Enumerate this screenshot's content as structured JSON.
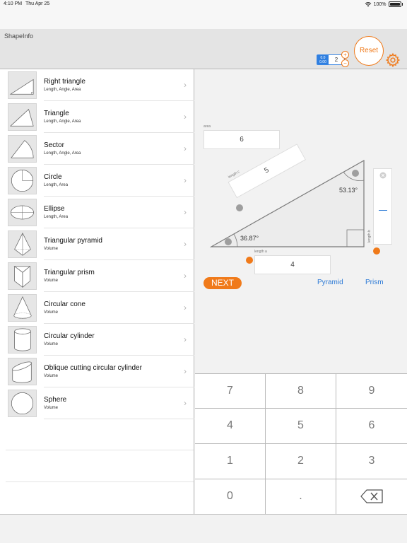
{
  "status_bar": {
    "time": "4:10 PM",
    "date": "Thu Apr 25",
    "battery": "100%"
  },
  "app": {
    "title": "ShapeInfo"
  },
  "toolbar": {
    "decimal_badge_top": "0.0",
    "decimal_badge_bottom": "0.00",
    "decimal_value": "2",
    "plus_label": "+",
    "minus_label": "−",
    "reset_label": "Reset"
  },
  "sidebar": {
    "items": [
      {
        "name": "Right triangle",
        "sub": "Length, Angle, Area",
        "icon": "right-triangle-icon"
      },
      {
        "name": "Triangle",
        "sub": "Length, Angle, Area",
        "icon": "triangle-icon"
      },
      {
        "name": "Sector",
        "sub": "Length, Angle, Area",
        "icon": "sector-icon"
      },
      {
        "name": "Circle",
        "sub": "Length, Area",
        "icon": "circle-icon"
      },
      {
        "name": "Ellipse",
        "sub": "Length, Area",
        "icon": "ellipse-icon"
      },
      {
        "name": "Triangular pyramid",
        "sub": "Volume",
        "icon": "triangular-pyramid-icon"
      },
      {
        "name": "Triangular prism",
        "sub": "Volume",
        "icon": "triangular-prism-icon"
      },
      {
        "name": "Circular cone",
        "sub": "Volume",
        "icon": "circular-cone-icon"
      },
      {
        "name": "Circular cylinder",
        "sub": "Volume",
        "icon": "circular-cylinder-icon"
      },
      {
        "name": "Oblique cutting circular cylinder",
        "sub": "Volume",
        "icon": "oblique-cylinder-icon"
      },
      {
        "name": "Sphere",
        "sub": "Volume",
        "icon": "sphere-icon"
      }
    ]
  },
  "calculator": {
    "area_label": "area",
    "area_value": "6",
    "length_c_label": "length c",
    "length_c_value": "5",
    "length_a_label": "length a",
    "length_a_value": "4",
    "length_b_label": "length b",
    "angle_top": "53.13°",
    "angle_left": "36.87°",
    "next_label": "NEXT",
    "pyramid_label": "Pyramid",
    "prism_label": "Prism"
  },
  "keypad": {
    "keys": [
      "7",
      "8",
      "9",
      "4",
      "5",
      "6",
      "1",
      "2",
      "3",
      "0",
      "."
    ],
    "delete_icon": "backspace-icon"
  },
  "colors": {
    "accent": "#f07a1a",
    "link": "#2c7ad6",
    "decimal": "#2f7fe0"
  }
}
